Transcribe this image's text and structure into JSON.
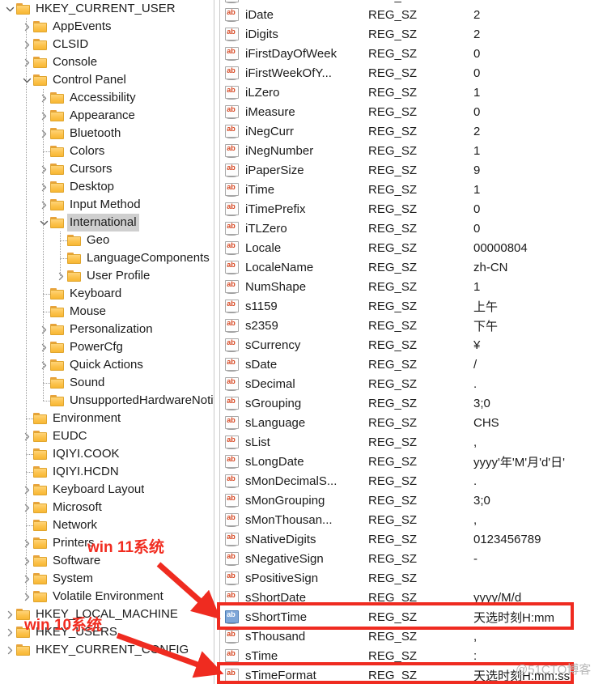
{
  "tree": {
    "items": [
      {
        "label": "HKEY_CURRENT_USER",
        "depth": 0,
        "twisty": "expanded"
      },
      {
        "label": "AppEvents",
        "depth": 1,
        "twisty": "collapsed"
      },
      {
        "label": "CLSID",
        "depth": 1,
        "twisty": "collapsed"
      },
      {
        "label": "Console",
        "depth": 1,
        "twisty": "collapsed"
      },
      {
        "label": "Control Panel",
        "depth": 1,
        "twisty": "expanded"
      },
      {
        "label": "Accessibility",
        "depth": 2,
        "twisty": "collapsed"
      },
      {
        "label": "Appearance",
        "depth": 2,
        "twisty": "collapsed"
      },
      {
        "label": "Bluetooth",
        "depth": 2,
        "twisty": "collapsed"
      },
      {
        "label": "Colors",
        "depth": 2,
        "twisty": "none"
      },
      {
        "label": "Cursors",
        "depth": 2,
        "twisty": "collapsed"
      },
      {
        "label": "Desktop",
        "depth": 2,
        "twisty": "collapsed"
      },
      {
        "label": "Input Method",
        "depth": 2,
        "twisty": "collapsed"
      },
      {
        "label": "International",
        "depth": 2,
        "twisty": "expanded",
        "selected": true
      },
      {
        "label": "Geo",
        "depth": 3,
        "twisty": "none"
      },
      {
        "label": "LanguageComponents",
        "depth": 3,
        "twisty": "none"
      },
      {
        "label": "User Profile",
        "depth": 3,
        "twisty": "collapsed"
      },
      {
        "label": "Keyboard",
        "depth": 2,
        "twisty": "none"
      },
      {
        "label": "Mouse",
        "depth": 2,
        "twisty": "none"
      },
      {
        "label": "Personalization",
        "depth": 2,
        "twisty": "collapsed"
      },
      {
        "label": "PowerCfg",
        "depth": 2,
        "twisty": "collapsed"
      },
      {
        "label": "Quick Actions",
        "depth": 2,
        "twisty": "collapsed"
      },
      {
        "label": "Sound",
        "depth": 2,
        "twisty": "none"
      },
      {
        "label": "UnsupportedHardwareNotificationCache",
        "depth": 2,
        "twisty": "none"
      },
      {
        "label": "Environment",
        "depth": 1,
        "twisty": "none"
      },
      {
        "label": "EUDC",
        "depth": 1,
        "twisty": "collapsed"
      },
      {
        "label": "IQIYI.COOK",
        "depth": 1,
        "twisty": "none"
      },
      {
        "label": "IQIYI.HCDN",
        "depth": 1,
        "twisty": "none"
      },
      {
        "label": "Keyboard Layout",
        "depth": 1,
        "twisty": "collapsed"
      },
      {
        "label": "Microsoft",
        "depth": 1,
        "twisty": "collapsed"
      },
      {
        "label": "Network",
        "depth": 1,
        "twisty": "none"
      },
      {
        "label": "Printers",
        "depth": 1,
        "twisty": "collapsed"
      },
      {
        "label": "Software",
        "depth": 1,
        "twisty": "collapsed"
      },
      {
        "label": "System",
        "depth": 1,
        "twisty": "collapsed"
      },
      {
        "label": "Volatile Environment",
        "depth": 1,
        "twisty": "collapsed"
      },
      {
        "label": "HKEY_LOCAL_MACHINE",
        "depth": 0,
        "twisty": "collapsed"
      },
      {
        "label": "HKEY_USERS",
        "depth": 0,
        "twisty": "collapsed"
      },
      {
        "label": "HKEY_CURRENT_CONFIG",
        "depth": 0,
        "twisty": "collapsed"
      }
    ]
  },
  "values": {
    "rows": [
      {
        "name": "iDate",
        "type": "REG_SZ",
        "data": "2"
      },
      {
        "name": "iDigits",
        "type": "REG_SZ",
        "data": "2"
      },
      {
        "name": "iFirstDayOfWeek",
        "type": "REG_SZ",
        "data": "0"
      },
      {
        "name": "iFirstWeekOfY...",
        "type": "REG_SZ",
        "data": "0"
      },
      {
        "name": "iLZero",
        "type": "REG_SZ",
        "data": "1"
      },
      {
        "name": "iMeasure",
        "type": "REG_SZ",
        "data": "0"
      },
      {
        "name": "iNegCurr",
        "type": "REG_SZ",
        "data": "2"
      },
      {
        "name": "iNegNumber",
        "type": "REG_SZ",
        "data": "1"
      },
      {
        "name": "iPaperSize",
        "type": "REG_SZ",
        "data": "9"
      },
      {
        "name": "iTime",
        "type": "REG_SZ",
        "data": "1"
      },
      {
        "name": "iTimePrefix",
        "type": "REG_SZ",
        "data": "0"
      },
      {
        "name": "iTLZero",
        "type": "REG_SZ",
        "data": "0"
      },
      {
        "name": "Locale",
        "type": "REG_SZ",
        "data": "00000804"
      },
      {
        "name": "LocaleName",
        "type": "REG_SZ",
        "data": "zh-CN"
      },
      {
        "name": "NumShape",
        "type": "REG_SZ",
        "data": "1"
      },
      {
        "name": "s1159",
        "type": "REG_SZ",
        "data": "上午"
      },
      {
        "name": "s2359",
        "type": "REG_SZ",
        "data": "下午"
      },
      {
        "name": "sCurrency",
        "type": "REG_SZ",
        "data": "¥"
      },
      {
        "name": "sDate",
        "type": "REG_SZ",
        "data": "/"
      },
      {
        "name": "sDecimal",
        "type": "REG_SZ",
        "data": "."
      },
      {
        "name": "sGrouping",
        "type": "REG_SZ",
        "data": "3;0"
      },
      {
        "name": "sLanguage",
        "type": "REG_SZ",
        "data": "CHS"
      },
      {
        "name": "sList",
        "type": "REG_SZ",
        "data": ","
      },
      {
        "name": "sLongDate",
        "type": "REG_SZ",
        "data": "yyyy'年'M'月'd'日'"
      },
      {
        "name": "sMonDecimalS...",
        "type": "REG_SZ",
        "data": "."
      },
      {
        "name": "sMonGrouping",
        "type": "REG_SZ",
        "data": "3;0"
      },
      {
        "name": "sMonThousan...",
        "type": "REG_SZ",
        "data": ","
      },
      {
        "name": "sNativeDigits",
        "type": "REG_SZ",
        "data": "0123456789"
      },
      {
        "name": "sNegativeSign",
        "type": "REG_SZ",
        "data": "-"
      },
      {
        "name": "sPositiveSign",
        "type": "REG_SZ",
        "data": ""
      },
      {
        "name": "sShortDate",
        "type": "REG_SZ",
        "data": "yyyy/M/d"
      },
      {
        "name": "sShortTime",
        "type": "REG_SZ",
        "data": "天选时刻H:mm",
        "selected": true,
        "highlighted": true
      },
      {
        "name": "sThousand",
        "type": "REG_SZ",
        "data": ","
      },
      {
        "name": "sTime",
        "type": "REG_SZ",
        "data": ":"
      },
      {
        "name": "sTimeFormat",
        "type": "REG_SZ",
        "data": "天选时刻H:mm:ss",
        "highlighted": true
      }
    ]
  },
  "annotations": {
    "win11_label": "win 11系统",
    "win10_label": "win 10系统",
    "watermark": "@51CTO博客",
    "accent_red": "#ef2b20"
  }
}
